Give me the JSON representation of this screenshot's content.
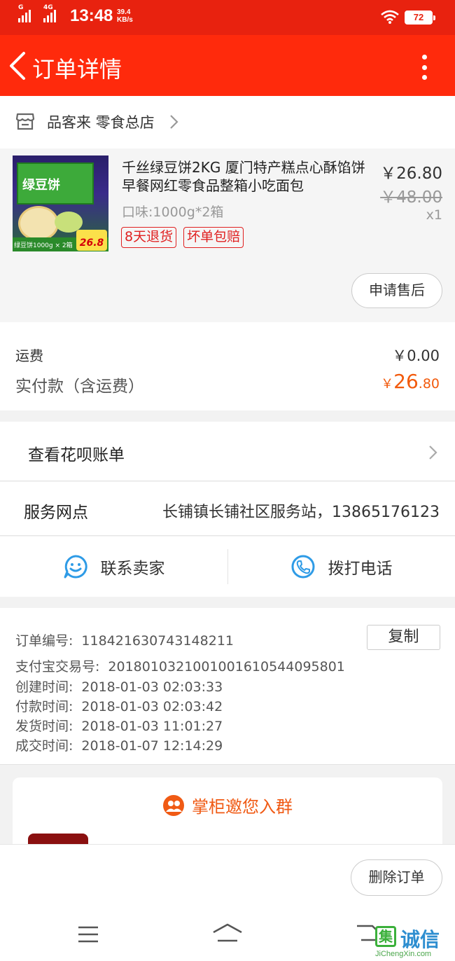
{
  "status_bar": {
    "network_g": "G",
    "network_4g": "4G",
    "time": "13:48",
    "speed_value": "39.4",
    "speed_unit": "KB/s",
    "battery": "72"
  },
  "header": {
    "title": "订单详情"
  },
  "shop": {
    "name": "品客来 零食总店"
  },
  "product": {
    "title": "千丝绿豆饼2KG 厦门特产糕点心酥馅饼早餐网红零食品整箱小吃面包",
    "spec": "口味:1000g*2箱",
    "tags": [
      "8天退货",
      "坏单包赔"
    ],
    "price": "￥26.80",
    "original_price": "￥48.00",
    "quantity": "x1",
    "image": {
      "box_text": "绿豆饼",
      "strip_label": "绿豆饼1000g × 2箱",
      "promo_price": "26.8"
    },
    "after_sale_label": "申请售后"
  },
  "fees": {
    "shipping_label": "运费",
    "shipping_value": "￥0.00",
    "paid_label": "实付款（含运费）",
    "paid_currency": "￥",
    "paid_integer": "26",
    "paid_decimal": ".80"
  },
  "huabei": {
    "label": "查看花呗账单"
  },
  "service": {
    "label": "服务网点",
    "value": "长铺镇长铺社区服务站，13865176123"
  },
  "contact": {
    "seller_label": "联系卖家",
    "call_label": "拨打电话"
  },
  "order_info": {
    "copy_label": "复制",
    "lines": [
      {
        "label": "订单编号:",
        "value": "118421630743148211"
      },
      {
        "label": "支付宝交易号:",
        "value": "2018010321001001610544095801"
      },
      {
        "label": "创建时间:",
        "value": "2018-01-03 02:03:33"
      },
      {
        "label": "付款时间:",
        "value": "2018-01-03 02:03:42"
      },
      {
        "label": "发货时间:",
        "value": "2018-01-03 11:01:27"
      },
      {
        "label": "成交时间:",
        "value": "2018-01-07 12:14:29"
      }
    ]
  },
  "group": {
    "title": "掌柜邀您入群"
  },
  "bottom": {
    "delete_label": "删除订单"
  },
  "watermark": {
    "badge": "集",
    "text": "诚信",
    "url": "JiChengXin.com"
  },
  "colors": {
    "header_red": "#ff2a0c",
    "status_red": "#e8220f",
    "price_orange": "#f25a0c",
    "tag_red": "#e02020",
    "contact_blue": "#2e9be6",
    "group_orange": "#f05a14"
  },
  "icons": {
    "back": "chevron-left-icon",
    "more": "more-vertical-icon",
    "shop": "store-icon",
    "chevron": "chevron-right-icon",
    "seller": "smile-chat-icon",
    "phone": "phone-icon",
    "group": "people-icon",
    "nav_menu": "menu-icon",
    "nav_home": "home-icon",
    "nav_back": "back-icon"
  }
}
